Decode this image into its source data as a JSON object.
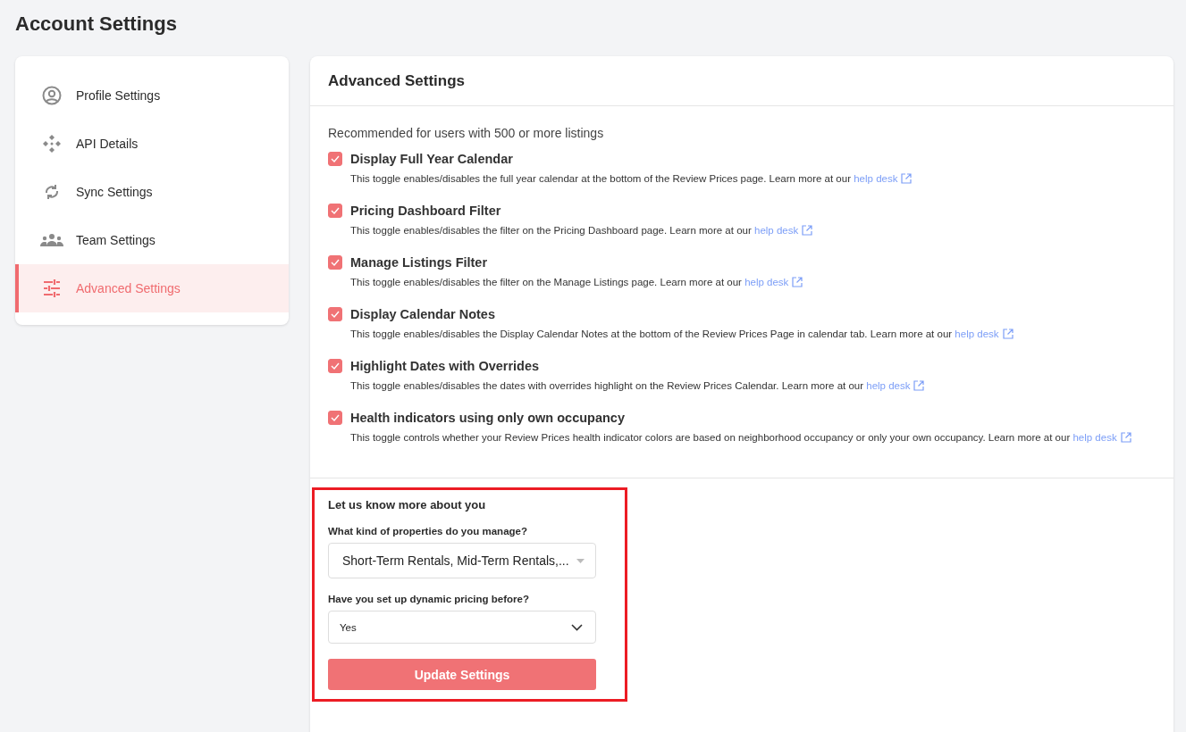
{
  "page_title": "Account Settings",
  "sidebar": {
    "items": [
      {
        "label": "Profile Settings",
        "selected": false
      },
      {
        "label": "API Details",
        "selected": false
      },
      {
        "label": "Sync Settings",
        "selected": false
      },
      {
        "label": "Team Settings",
        "selected": false
      },
      {
        "label": "Advanced Settings",
        "selected": true
      }
    ]
  },
  "panel": {
    "title": "Advanced Settings",
    "intro": "Recommended for users with 500 or more listings",
    "options": [
      {
        "label": "Display Full Year Calendar",
        "checked": true,
        "description": "This toggle enables/disables the full year calendar at the bottom of the Review Prices page. Learn more at our",
        "link": "help desk"
      },
      {
        "label": "Pricing Dashboard Filter",
        "checked": true,
        "description": "This toggle enables/disables the filter on the Pricing Dashboard page. Learn more at our",
        "link": "help desk"
      },
      {
        "label": "Manage Listings Filter",
        "checked": true,
        "description": "This toggle enables/disables the filter on the Manage Listings page. Learn more at our",
        "link": "help desk"
      },
      {
        "label": "Display Calendar Notes",
        "checked": true,
        "description": "This toggle enables/disables the Display Calendar Notes at the bottom of the Review Prices Page in calendar tab. Learn more at our",
        "link": "help desk"
      },
      {
        "label": "Highlight Dates with Overrides",
        "checked": true,
        "description": "This toggle enables/disables the dates with overrides highlight on the Review Prices Calendar. Learn more at our",
        "link": "help desk"
      },
      {
        "label": "Health indicators using only own occupancy",
        "checked": true,
        "description": "This toggle controls whether your Review Prices health indicator colors are based on neighborhood occupancy or only your own occupancy. Learn more at our",
        "link": "help desk"
      }
    ]
  },
  "survey": {
    "title": "Let us know more about you",
    "fields": [
      {
        "label": "What kind of properties do you manage?",
        "value": "Short-Term Rentals, Mid-Term Rentals,...",
        "kind": "multiselect"
      },
      {
        "label": "Have you set up dynamic pricing before?",
        "value": "Yes",
        "kind": "select"
      }
    ],
    "button": "Update Settings"
  }
}
